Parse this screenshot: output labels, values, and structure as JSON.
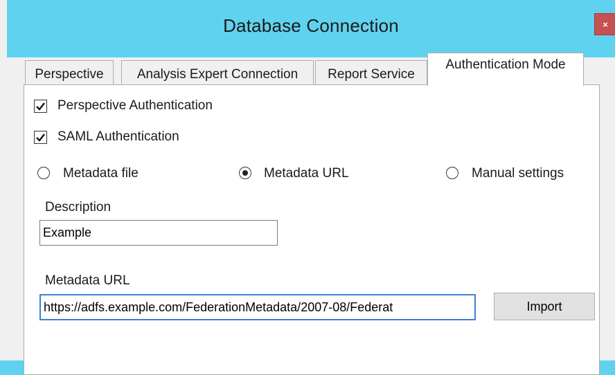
{
  "window": {
    "title": "Database Connection",
    "close_label": "×"
  },
  "tabs": [
    {
      "label": "Perspective",
      "active": false
    },
    {
      "label": "Analysis Expert Connection",
      "active": false
    },
    {
      "label": "Report Service",
      "active": false
    },
    {
      "label": "Authentication Mode",
      "active": true
    }
  ],
  "auth": {
    "perspective_auth": {
      "label": "Perspective Authentication",
      "checked": true
    },
    "saml_auth": {
      "label": "SAML Authentication",
      "checked": true
    },
    "source_options": [
      {
        "label": "Metadata file",
        "selected": false
      },
      {
        "label": "Metadata URL",
        "selected": true
      },
      {
        "label": "Manual settings",
        "selected": false
      }
    ],
    "description": {
      "label": "Description",
      "value": "Example"
    },
    "metadata_url": {
      "label": "Metadata URL",
      "value": "https://adfs.example.com/FederationMetadata/2007-08/Federat"
    },
    "import_label": "Import"
  }
}
